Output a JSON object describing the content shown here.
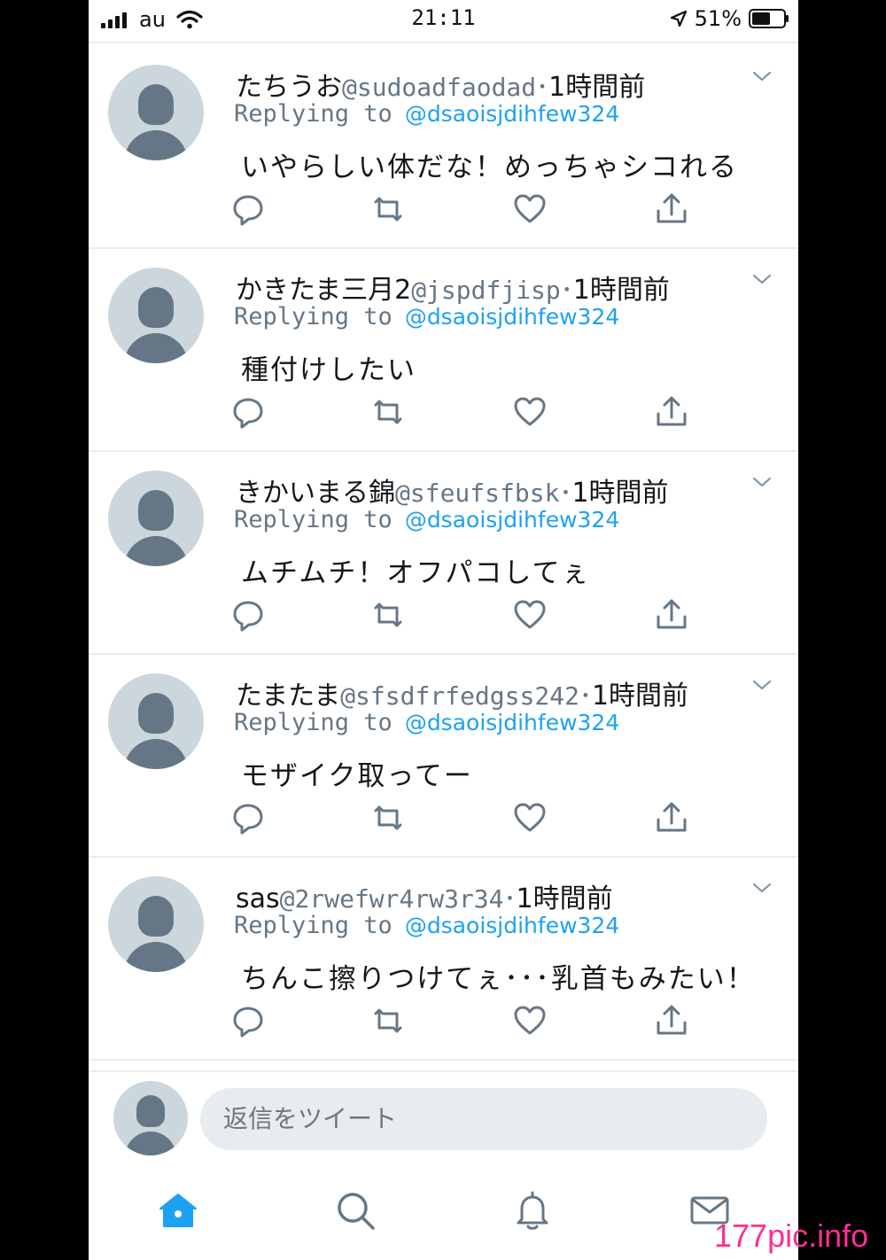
{
  "status": {
    "carrier": "au",
    "time": "21:11",
    "battery": "51%"
  },
  "tweets": [
    {
      "name": "たちうお",
      "handle": "@sudoadfaodad",
      "time": "1時間前",
      "reply_label": "Replying to",
      "reply_to": "@dsaoisjdihfew324",
      "text": "いやらしい体だな！めっちゃシコれる"
    },
    {
      "name": "かきたま三月2",
      "handle": "@jspdfjisp",
      "time": "1時間前",
      "reply_label": "Replying to",
      "reply_to": "@dsaoisjdihfew324",
      "text": "種付けしたい"
    },
    {
      "name": "きかいまる錦",
      "handle": "@sfeufsfbsk",
      "time": "1時間前",
      "reply_label": "Replying to",
      "reply_to": "@dsaoisjdihfew324",
      "text": "ムチムチ！オフパコしてぇ"
    },
    {
      "name": "たまたま",
      "handle": "@sfsdfrfedgss242",
      "time": "1時間前",
      "reply_label": "Replying to",
      "reply_to": "@dsaoisjdihfew324",
      "text": "モザイク取ってー"
    },
    {
      "name": "sas",
      "handle": "@2rwefwr4rw3r34",
      "time": "1時間前",
      "reply_label": "Replying to",
      "reply_to": "@dsaoisjdihfew324",
      "text": "ちんこ擦りつけてぇ･･･乳首もみたい！"
    }
  ],
  "reply_box": {
    "placeholder": "返信をツイート"
  },
  "watermark": "177pic.info",
  "colors": {
    "accent": "#1da1f2",
    "muted": "#657786",
    "border": "#e6ecf0",
    "watermark": "#ff2d95"
  }
}
